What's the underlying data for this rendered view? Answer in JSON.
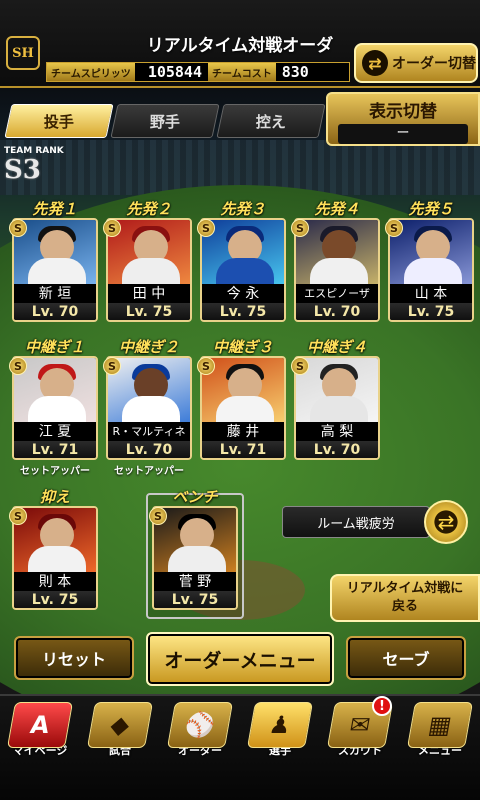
{
  "header": {
    "logo": "SH",
    "title": "リアルタイム対戦オーダー",
    "spirit_label": "チームスピリッツ",
    "spirit_value": "105844",
    "cost_label": "チームコスト",
    "cost_value": "830",
    "order_switch_label": "オーダー切替"
  },
  "tabs": [
    {
      "label": "投手",
      "active": true
    },
    {
      "label": "野手",
      "active": false
    },
    {
      "label": "控え",
      "active": false
    }
  ],
  "display_switch": {
    "label": "表示切替",
    "value": "ー"
  },
  "team_rank": {
    "label": "TEAM RANK",
    "value": "S3"
  },
  "starters": [
    {
      "role": "先発１",
      "name": "新 垣",
      "level": "Lv. 70",
      "grade": "S"
    },
    {
      "role": "先発２",
      "name": "田 中",
      "level": "Lv. 75",
      "grade": "S"
    },
    {
      "role": "先発３",
      "name": "今 永",
      "level": "Lv. 75",
      "grade": "S"
    },
    {
      "role": "先発４",
      "name": "エスピノーザ",
      "level": "Lv. 70",
      "grade": "S"
    },
    {
      "role": "先発５",
      "name": "山 本",
      "level": "Lv. 75",
      "grade": "S"
    }
  ],
  "relievers": [
    {
      "role": "中継ぎ１",
      "name": "江 夏",
      "level": "Lv. 71",
      "grade": "S",
      "tag": "セットアッパー"
    },
    {
      "role": "中継ぎ２",
      "name": "R・マルティネス",
      "level": "Lv. 70",
      "grade": "S",
      "tag": "セットアッパー"
    },
    {
      "role": "中継ぎ３",
      "name": "藤 井",
      "level": "Lv. 71",
      "grade": "S",
      "tag": ""
    },
    {
      "role": "中継ぎ４",
      "name": "高 梨",
      "level": "Lv. 70",
      "grade": "S",
      "tag": ""
    }
  ],
  "closer": {
    "role": "抑え",
    "name": "則 本",
    "level": "Lv. 75",
    "grade": "S"
  },
  "bench": {
    "role": "ベンチ",
    "name": "菅 野",
    "level": "Lv. 75",
    "grade": "S"
  },
  "fatigue_label": "ルーム戦疲労",
  "back_label_line1": "リアルタイム対戦に",
  "back_label_line2": "戻る",
  "buttons": {
    "reset": "リセット",
    "order_menu": "オーダーメニュー",
    "save": "セーブ"
  },
  "nav": [
    {
      "label": "マイページ",
      "icon": "A"
    },
    {
      "label": "試合",
      "icon": "◆"
    },
    {
      "label": "オーダー",
      "icon": "⚾"
    },
    {
      "label": "選手",
      "icon": "♟"
    },
    {
      "label": "スカウト",
      "icon": "✉",
      "badge": "!"
    },
    {
      "label": "メニュー",
      "icon": "▦"
    }
  ]
}
